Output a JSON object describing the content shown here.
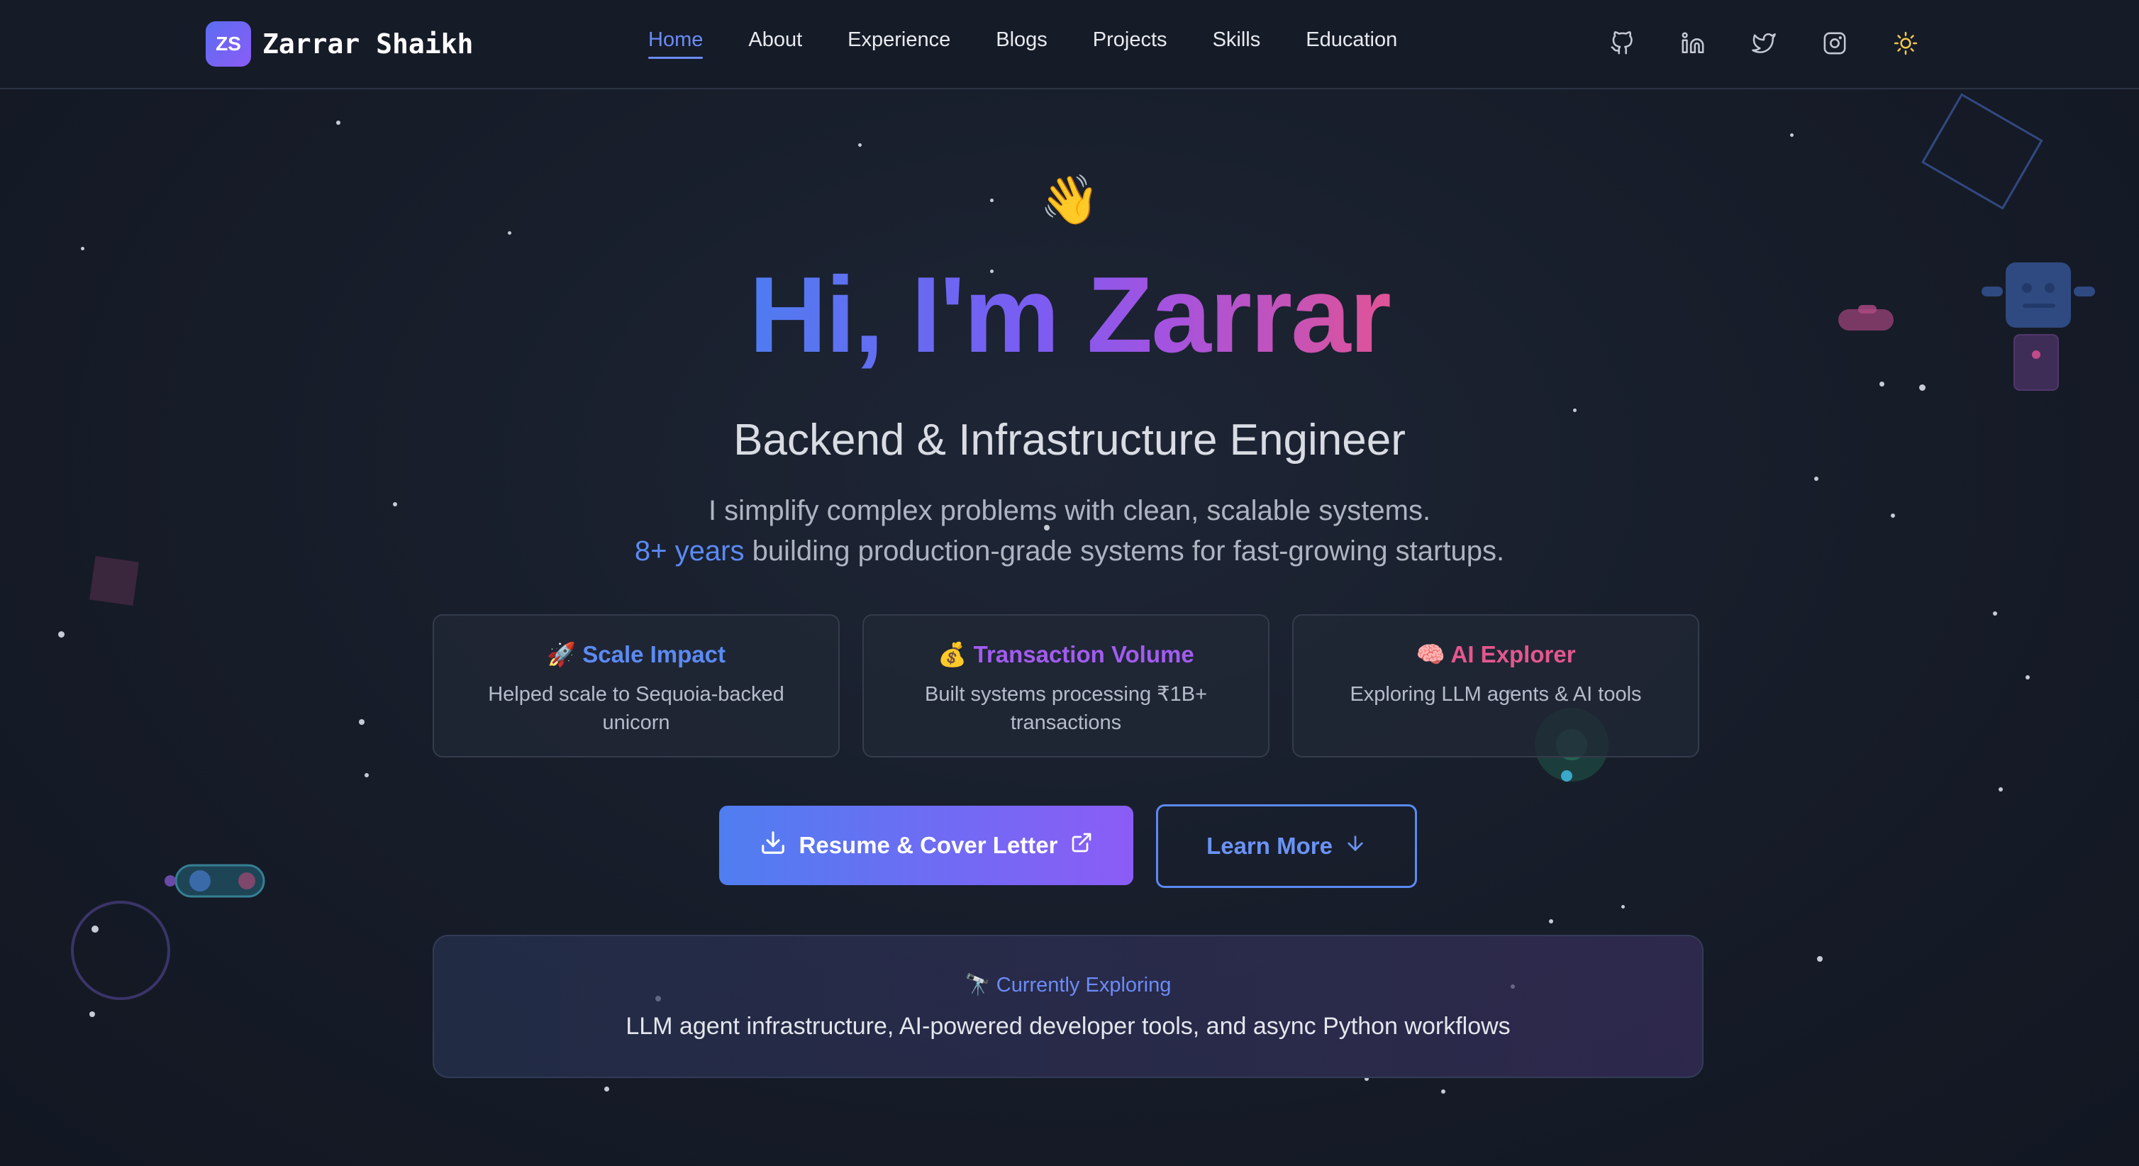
{
  "brand": {
    "initials": "ZS",
    "name": "Zarrar Shaikh"
  },
  "nav": {
    "items": [
      {
        "label": "Home",
        "active": true
      },
      {
        "label": "About",
        "active": false
      },
      {
        "label": "Experience",
        "active": false
      },
      {
        "label": "Blogs",
        "active": false
      },
      {
        "label": "Projects",
        "active": false
      },
      {
        "label": "Skills",
        "active": false
      },
      {
        "label": "Education",
        "active": false
      }
    ]
  },
  "social": [
    "github-icon",
    "linkedin-icon",
    "twitter-icon",
    "instagram-icon",
    "sun-icon"
  ],
  "hero": {
    "emoji": "👋",
    "title": "Hi, I'm Zarrar",
    "role": "Backend & Infrastructure Engineer",
    "tagline_line1": "I simplify complex problems with clean, scalable systems.",
    "tagline_highlight": "8+ years",
    "tagline_line2": " building production-grade systems for fast-growing startups."
  },
  "cards": [
    {
      "emoji": "🚀",
      "title": "Scale Impact",
      "desc": "Helped scale to Sequoia-backed unicorn",
      "color": "#5b8af4"
    },
    {
      "emoji": "💰",
      "title": "Transaction Volume",
      "desc": "Built systems processing ₹1B+ transactions",
      "color": "#a25cf0"
    },
    {
      "emoji": "🧠",
      "title": "AI Explorer",
      "desc": "Exploring LLM agents & AI tools",
      "color": "#e4578e"
    }
  ],
  "buttons": {
    "resume": "Resume & Cover Letter",
    "learn_more": "Learn More"
  },
  "exploring": {
    "emoji": "🔭",
    "title": "Currently Exploring",
    "text": "LLM agent infrastructure, AI-powered developer tools, and async Python workflows"
  },
  "colors": {
    "accent": "#5b8af4",
    "purple": "#8b5cf6",
    "pink": "#e05396",
    "background": "#161c28"
  }
}
